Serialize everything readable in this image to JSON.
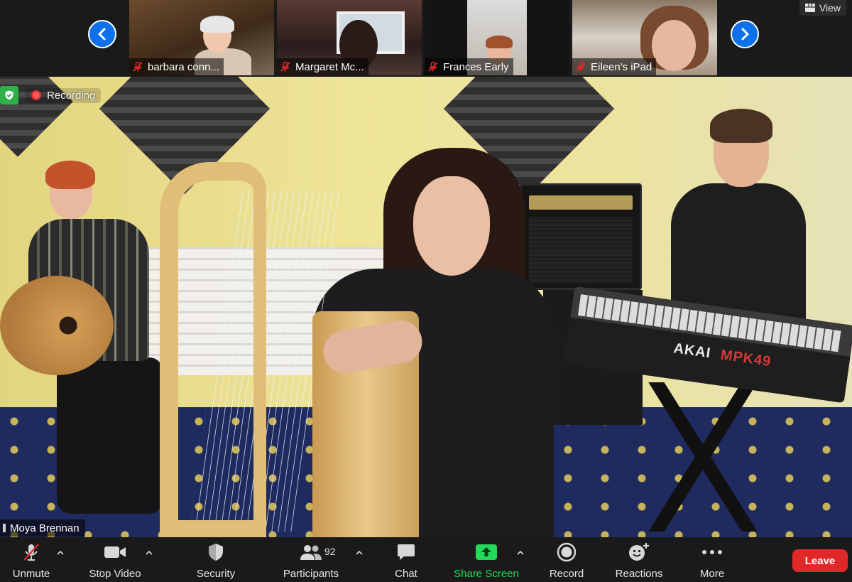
{
  "gallery": {
    "participants": [
      {
        "name": "barbara conn...",
        "muted": true
      },
      {
        "name": "Margaret Mc...",
        "muted": true
      },
      {
        "name": "Frances Early",
        "muted": true
      },
      {
        "name": "Eileen's iPad",
        "muted": true
      }
    ],
    "view_label": "View"
  },
  "main_video": {
    "recording_label": "Recording",
    "speaker_name": "Moya Brennan",
    "keyboard_brand": "AKAI",
    "keyboard_model": "MPK49"
  },
  "toolbar": {
    "unmute_label": "Unmute",
    "stop_video_label": "Stop Video",
    "security_label": "Security",
    "participants_label": "Participants",
    "participants_count": "92",
    "chat_label": "Chat",
    "share_screen_label": "Share Screen",
    "record_label": "Record",
    "reactions_label": "Reactions",
    "more_label": "More",
    "leave_label": "Leave"
  },
  "colors": {
    "nav_accent": "#0e71eb",
    "share_green": "#23d959",
    "leave_red": "#e02828",
    "muted_red": "#e02828",
    "secure_green": "#2db24a"
  },
  "icons": {
    "nav_prev": "chevron-left-icon",
    "nav_next": "chevron-right-icon",
    "muted_mic": "muted-mic-icon",
    "view": "grid-view-icon",
    "secure": "shield-check-icon",
    "recording": "record-dot-icon",
    "unmute": "mic-off-icon",
    "stop_video": "video-camera-icon",
    "security": "shield-icon",
    "participants": "people-icon",
    "chat": "chat-bubble-icon",
    "share": "share-up-arrow-icon",
    "record": "record-circle-icon",
    "reactions": "emoji-plus-icon",
    "more": "ellipsis-icon"
  }
}
